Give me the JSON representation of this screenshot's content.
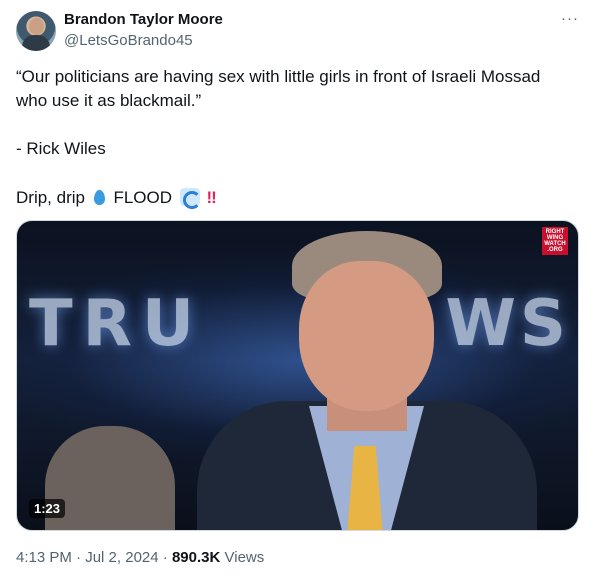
{
  "author": {
    "display_name": "Brandon Taylor Moore",
    "handle": "@LetsGoBrando45",
    "avatar_icon": "avatar"
  },
  "more_icon": "more-icon",
  "more_label": "···",
  "tweet": {
    "line1": "“Our politicians are having sex with little girls in front of Israeli Mossad who use it as blackmail.”",
    "line2": "- Rick Wiles",
    "line3_a": "Drip, drip",
    "line3_b": "FLOOD",
    "exclaim": "‼"
  },
  "media": {
    "logo_left": "TRU",
    "logo_right": "WS",
    "watermark": "RIGHT WING WATCH .ORG",
    "duration": "1:23"
  },
  "footer": {
    "time": "4:13 PM",
    "sep1": "·",
    "date": "Jul 2, 2024",
    "sep2": "·",
    "views_count": "890.3K",
    "views_label": "Views"
  },
  "colors": {
    "text_primary": "#0f1419",
    "text_secondary": "#536471",
    "exclaim": "#e0245e"
  }
}
